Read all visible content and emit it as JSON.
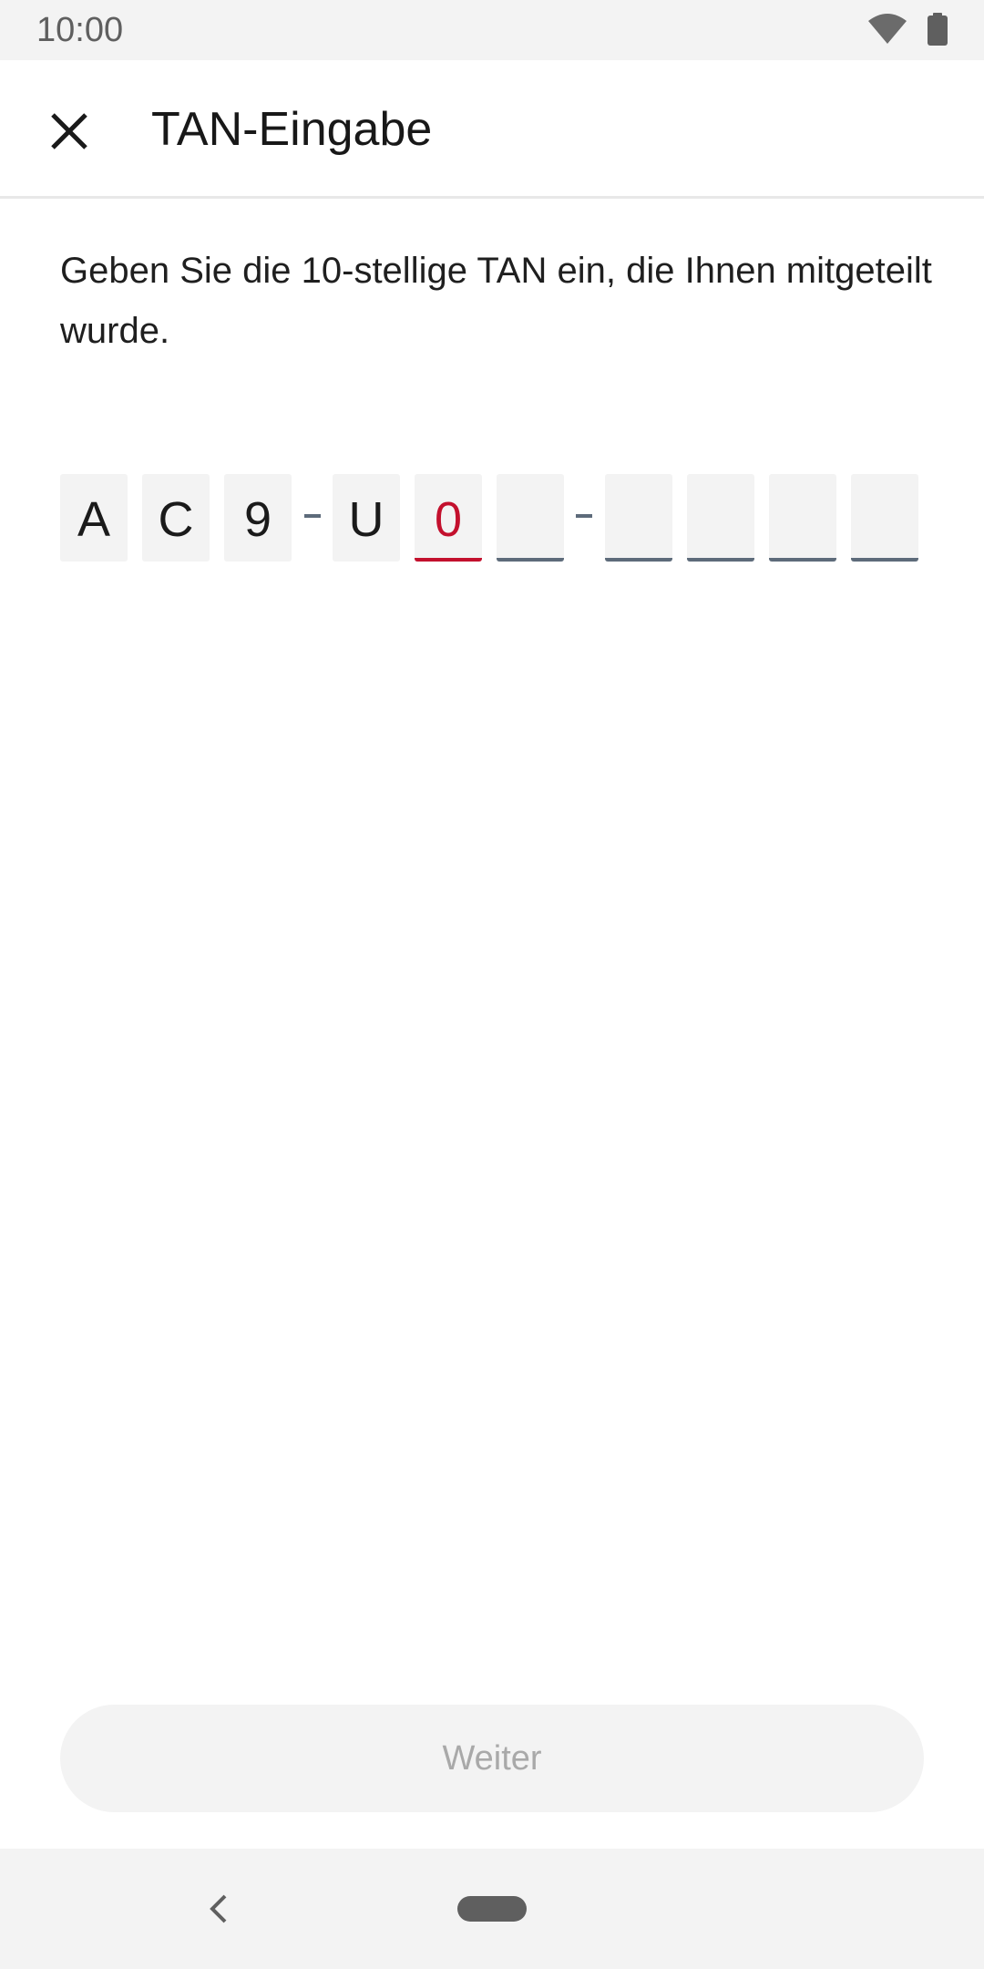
{
  "status_bar": {
    "time": "10:00",
    "icons": [
      "wifi-icon",
      "battery-icon"
    ]
  },
  "app_bar": {
    "title": "TAN-Eingabe",
    "close_icon": "close-icon"
  },
  "instructions": "Geben Sie die 10-stellige TAN ein, die Ihnen mitgeteilt wurde.",
  "tan": {
    "length": 10,
    "characters": [
      "A",
      "C",
      "9",
      "U",
      "0",
      "",
      "",
      "",
      "",
      ""
    ],
    "separator": "-",
    "active_index": 4
  },
  "actions": {
    "continue_label": "Weiter",
    "continue_enabled": false
  },
  "navigation": {
    "back_icon": "nav-back-icon",
    "home_icon": "nav-home-pill-icon"
  },
  "colors": {
    "accent": "#c3102d",
    "box_background": "#f3f3f3",
    "empty_underline": "#5d6b7a",
    "text_primary": "#1a1a1a",
    "disabled_text": "#a9a9a9"
  }
}
